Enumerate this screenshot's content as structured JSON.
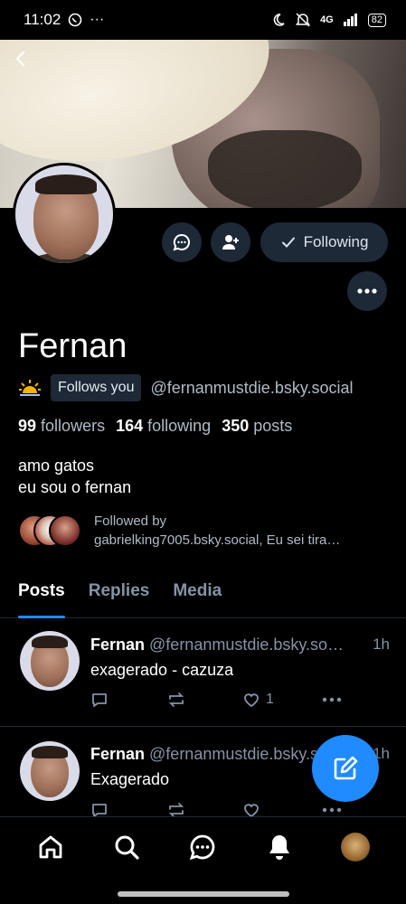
{
  "status_bar": {
    "time": "11:02",
    "network": "4G",
    "battery": "82"
  },
  "profile": {
    "display_name": "Fernan",
    "follows_you_label": "Follows you",
    "handle": "@fernanmustdie.bsky.social",
    "followers_count": "99",
    "followers_label": "followers",
    "following_count": "164",
    "following_label": "following",
    "posts_count": "350",
    "posts_label": "posts",
    "bio_line1": "amo gatos",
    "bio_line2": "eu sou o fernan",
    "followed_by_line1": "Followed by",
    "followed_by_line2": "gabrielking7005.bsky.social, Eu sei tira…"
  },
  "actions": {
    "following_label": "Following"
  },
  "tabs": [
    {
      "label": "Posts",
      "active": true
    },
    {
      "label": "Replies",
      "active": false
    },
    {
      "label": "Media",
      "active": false
    }
  ],
  "posts": [
    {
      "author": "Fernan",
      "handle": "@fernanmustdie.bsky.so…",
      "time": "1h",
      "text": "exagerado - cazuza",
      "like_count": "1"
    },
    {
      "author": "Fernan",
      "handle": "@fernanmustdie.bsky.so…",
      "time": "1h",
      "text": "Exagerado",
      "like_count": ""
    }
  ],
  "colors": {
    "accent": "#208bfe",
    "surface": "#1e2937",
    "muted_text": "#8493a6",
    "background": "#000000"
  },
  "icons": [
    "back-arrow-icon",
    "message-icon",
    "add-person-icon",
    "checkmark-icon",
    "more-icon",
    "sun-emoji-icon",
    "reply-icon",
    "repost-icon",
    "heart-icon",
    "compose-icon",
    "home-icon",
    "search-icon",
    "chat-icon",
    "bell-icon"
  ]
}
